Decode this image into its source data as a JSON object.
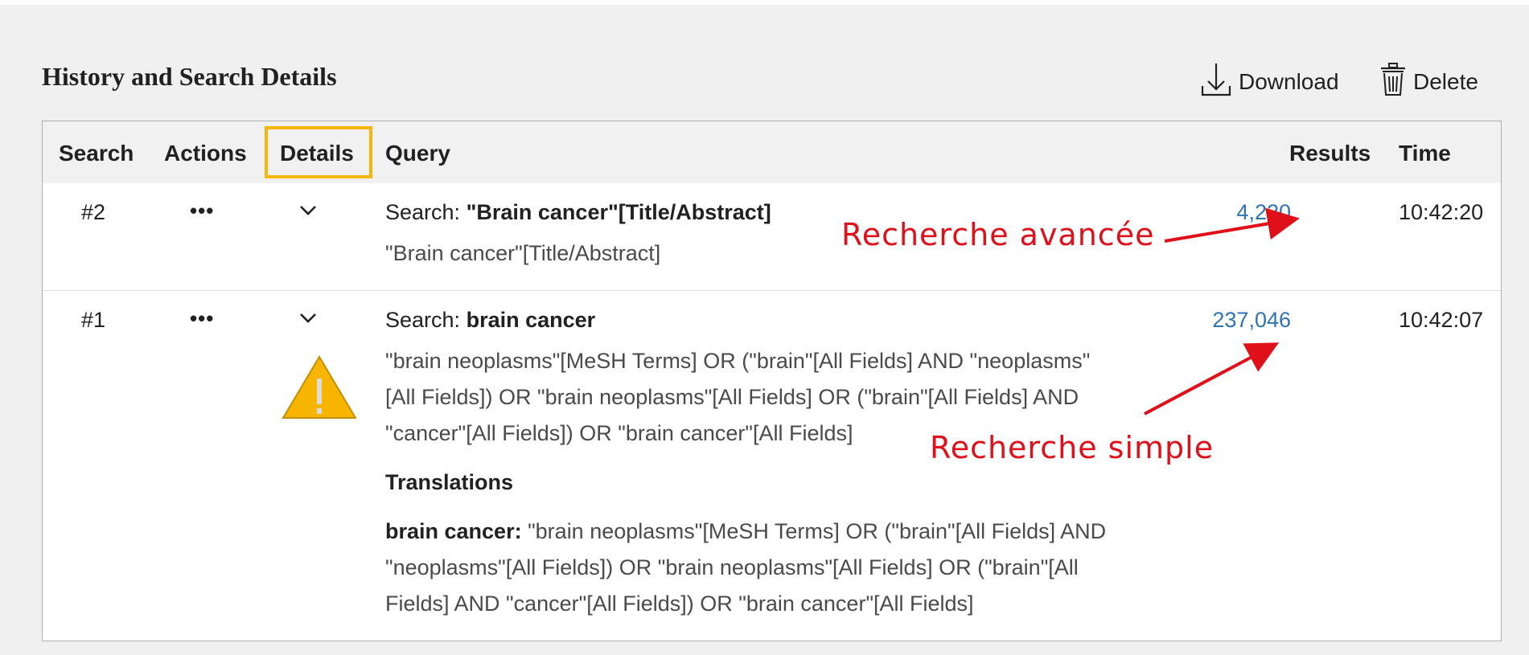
{
  "header": {
    "title": "History and Search Details",
    "download_label": "Download",
    "delete_label": "Delete"
  },
  "columns": {
    "search": "Search",
    "actions": "Actions",
    "details": "Details",
    "query": "Query",
    "results": "Results",
    "time": "Time"
  },
  "rows": [
    {
      "number": "#2",
      "actions": "•••",
      "details": "⌄",
      "search_prefix": "Search:",
      "search_term": "\"Brain cancer\"[Title/Abstract]",
      "details_lines": [
        "\"Brain cancer\"[Title/Abstract]"
      ],
      "results": "4,220",
      "time": "10:42:20"
    },
    {
      "number": "#1",
      "actions": "•••",
      "details": "⌄",
      "search_prefix": "Search:",
      "search_term": "brain cancer",
      "details_lines": [
        "\"brain neoplasms\"[MeSH Terms] OR (\"brain\"[All Fields] AND \"neoplasms\"",
        "[All Fields]) OR \"brain neoplasms\"[All Fields] OR (\"brain\"[All Fields] AND",
        "\"cancer\"[All Fields]) OR \"brain cancer\"[All Fields]"
      ],
      "translations_heading": "Translations",
      "translation_term": "brain cancer:",
      "translation_lines": [
        " \"brain neoplasms\"[MeSH Terms] OR (\"brain\"[All Fields] AND",
        "\"neoplasms\"[All Fields]) OR \"brain neoplasms\"[All Fields] OR (\"brain\"[All",
        "Fields] AND \"cancer\"[All Fields]) OR \"brain cancer\"[All Fields]"
      ],
      "results": "237,046",
      "time": "10:42:07",
      "warning_icon": "warning-triangle-icon"
    }
  ],
  "annotations": {
    "advanced": "Recherche avancée",
    "simple": "Recherche simple",
    "color": "#e0101a"
  },
  "colors": {
    "highlight": "#f5b70d",
    "link": "#2e74b5",
    "warning": "#f7b500"
  }
}
